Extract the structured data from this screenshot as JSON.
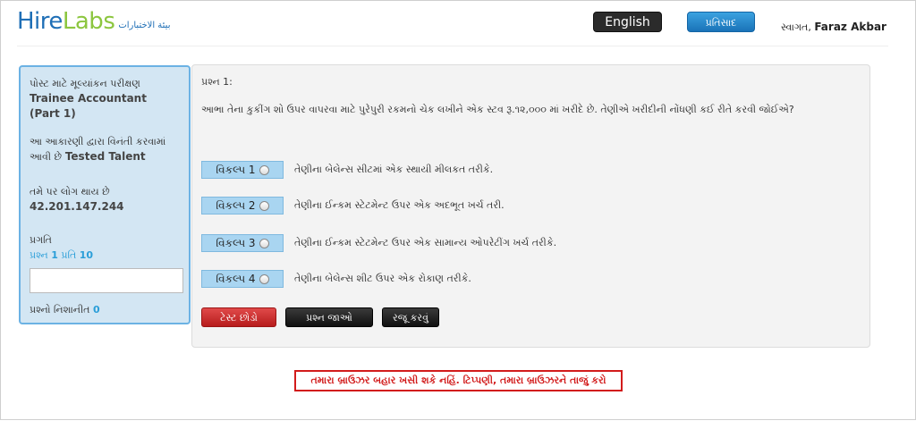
{
  "brand": {
    "name_part1": "Hire",
    "name_part2": "Labs",
    "arabic_tagline": "بيئة الاختبارات"
  },
  "header": {
    "language_button": "English",
    "feedback_button": "પ્રતિસાદ",
    "welcome_prefix": "સ્વાગત,",
    "user_name": "Faraz Akbar"
  },
  "sidebar": {
    "assessment_label": "પોસ્ટ માટે મૂલ્યાંકન પરીક્ષણ",
    "assessment_title": "Trainee Accountant (Part 1)",
    "requested_label": "આ આકારણી દ્વારા વિનંતી કરવામાં આવી છે",
    "requested_by": "Tested Talent",
    "login_label": "તમે પર લોગ થાય છે",
    "ip_address": "42.201.147.244",
    "progress_label": "પ્રગતિ",
    "progress_prefix": "પ્રશ્ન",
    "progress_current": "1",
    "progress_of": "પ્રતિ",
    "progress_total": "10",
    "marked_label": "પ્રશ્નો નિશાનીત",
    "marked_count": "0"
  },
  "question": {
    "number_label": "પ્રશ્ન 1:",
    "text": "આભા તેના કુકીંગ શો ઉપર વાપરવા માટે પુરેપુરી રકમનો ચેક લખીને એક સ્ટવ રૂ.૧૨,૦૦૦ માં ખરીદે છે. તેણીએ ખરીદીની નોંધણી કઈ રીતે કરવી જોઈએ?",
    "options": [
      {
        "label": "વિકલ્પ 1",
        "text": "તેણીના બેલેન્સ સીટમાં એક સ્થાયી મીલકત તરીકે."
      },
      {
        "label": "વિકલ્પ 2",
        "text": "તેણીના ઈન્કમ સ્ટેટમેન્ટ ઉપર એક અદભૂત ખર્ચ તરી."
      },
      {
        "label": "વિકલ્પ 3",
        "text": "તેણીના ઈન્કમ સ્ટેટમેન્ટ ઉપર એક સામાન્ય ઓપરેટીંગ ખર્ચ તરીકે."
      },
      {
        "label": "વિકલ્પ 4",
        "text": "તેણીના બેલેન્સ શીટ ઉપર એક રોકાણ તરીકે."
      }
    ]
  },
  "actions": {
    "quit_test": "ટેસ્ટ છોડો",
    "view_questions": "પ્રશ્ન જાઓ",
    "submit": "રજૂ કરવું"
  },
  "notice": "તમારા બ્રાઉઝર બહાર ખસી શકે નહિં. ટિપ્પણી, તમારા બ્રાઉઝરને તાજું કરો"
}
